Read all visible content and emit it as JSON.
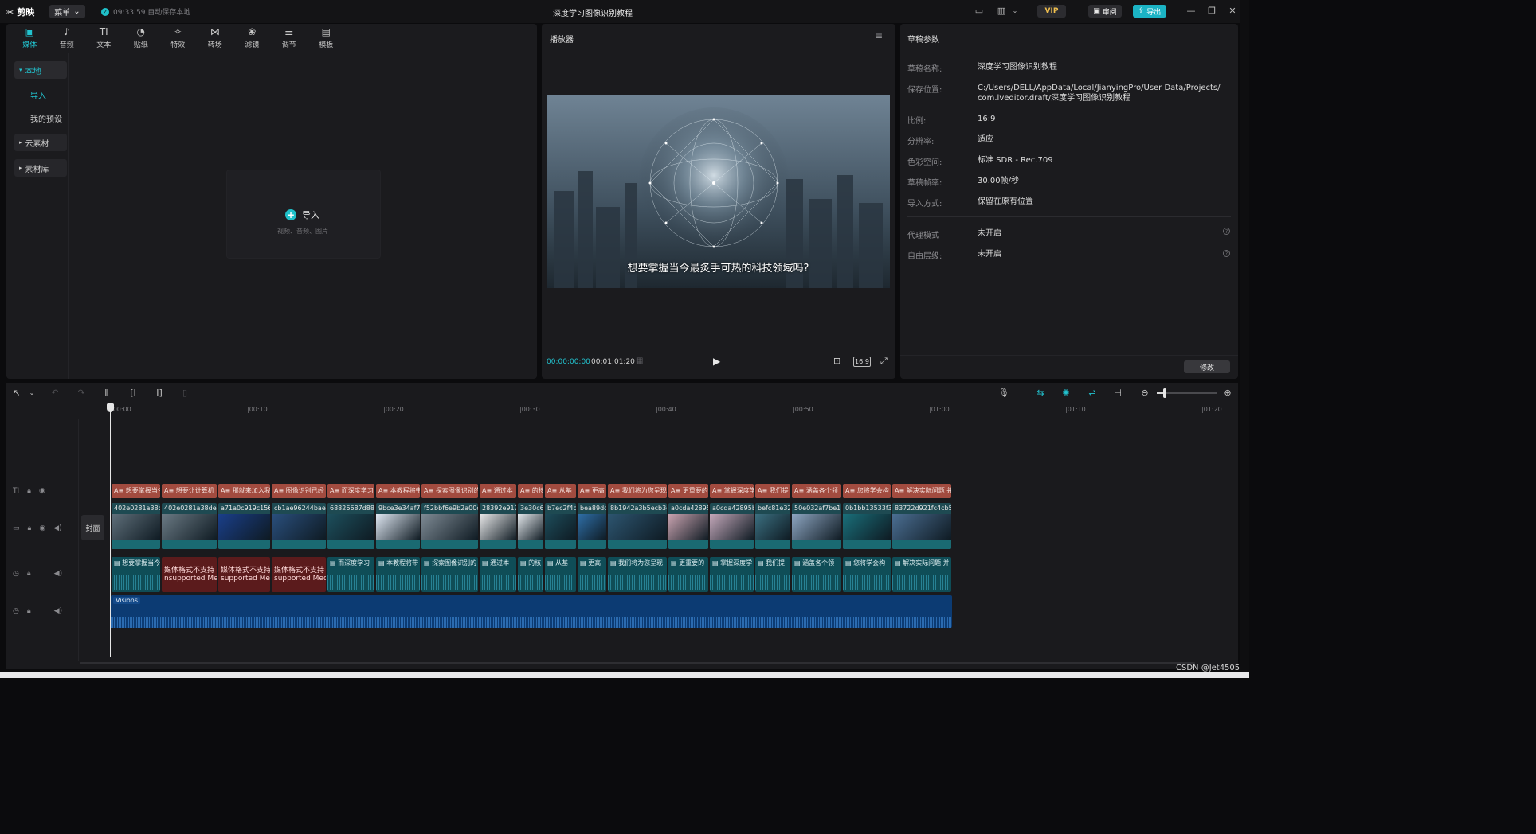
{
  "titlebar": {
    "app_name": "剪映",
    "menu_label": "菜单",
    "autosave": "09:33:59 自动保存本地",
    "project_title": "深度学习图像识别教程",
    "vip": "VIP",
    "review": "审阅",
    "export": "导出"
  },
  "tabs": [
    {
      "label": "媒体",
      "icon": "▣"
    },
    {
      "label": "音频",
      "icon": "♪"
    },
    {
      "label": "文本",
      "icon": "TI"
    },
    {
      "label": "贴纸",
      "icon": "◔"
    },
    {
      "label": "特效",
      "icon": "✧"
    },
    {
      "label": "转场",
      "icon": "⋈"
    },
    {
      "label": "滤镜",
      "icon": "❀"
    },
    {
      "label": "调节",
      "icon": "⚌"
    },
    {
      "label": "模板",
      "icon": "▤"
    }
  ],
  "sidebar": {
    "local": "本地",
    "import": "导入",
    "my_presets": "我的预设",
    "cloud": "云素材",
    "library": "素材库"
  },
  "import_card": {
    "label": "导入",
    "sub": "视频、音频、图片"
  },
  "player": {
    "title": "播放器",
    "subtitle": "想要掌握当今最炙手可热的科技领域吗?",
    "current_time": "00:00:00:00",
    "total_time": "00:01:01:20",
    "ratio": "16:9"
  },
  "params": {
    "title": "草稿参数",
    "rows": [
      {
        "label": "草稿名称:",
        "value": "深度学习图像识别教程"
      },
      {
        "label": "保存位置:",
        "value": "C:/Users/DELL/AppData/Local/JianyingPro/User Data/Projects/",
        "value2": "com.lveditor.draft/深度学习图像识别教程"
      },
      {
        "label": "比例:",
        "value": "16:9"
      },
      {
        "label": "分辨率:",
        "value": "适应"
      },
      {
        "label": "色彩空间:",
        "value": "标准 SDR - Rec.709"
      },
      {
        "label": "草稿帧率:",
        "value": "30.00帧/秒"
      },
      {
        "label": "导入方式:",
        "value": "保留在原有位置"
      },
      {
        "label": "代理模式",
        "value": "未开启"
      },
      {
        "label": "自由层级:",
        "value": "未开启"
      }
    ],
    "modify": "修改"
  },
  "ruler": [
    "|00:00",
    "|00:10",
    "|00:20",
    "|00:30",
    "|00:40",
    "|00:50",
    "|01:00",
    "|01:10",
    "|01:20"
  ],
  "cover": "封面",
  "text_clips": [
    "想要掌握当今",
    "想要让计算机",
    "那就来加入我",
    "图像识别已经",
    "而深度学习",
    "本教程将带",
    "探索图像识别的",
    "通过本",
    "的核",
    "从基",
    "更高",
    "我们将为您呈现",
    "更重要的",
    "掌握深度学",
    "我们提",
    "涵盖各个领",
    "您将学会构",
    "解决实际问题 并"
  ],
  "video_clips": [
    "402e0281a38c",
    "402e0281a38dec",
    "a71a0c919c156",
    "cb1ae96244bae8",
    "68826687d88",
    "9bce3e34af7",
    "f52bbf6e9b2a00c",
    "28392e912",
    "3e30c6",
    "b7ec2f4c",
    "bea89dc",
    "8b1942a3b5ecb3d",
    "a0cda42895",
    "a0cda42895bf",
    "befc81e32",
    "50e032af7be1l",
    "0b1bb13533f3",
    "83722d921fc4cb5"
  ],
  "audio_clips": [
    "想要掌握当今",
    "媒体格式不支持",
    "媒体格式不支持",
    "媒体格式不支持",
    "而深度学习",
    "本教程将带",
    "探索图像识别的",
    "通过本",
    "的核",
    "从基",
    "更高",
    "我们将为您呈现",
    "更重要的",
    "掌握深度学",
    "我们提",
    "涵盖各个领",
    "您将学会构",
    "解决实际问题 并"
  ],
  "unsupported_sub": [
    "nsupported Med",
    "supported Mec",
    "supported Med"
  ],
  "music": "Visions",
  "watermark": "CSDN @Jet4505"
}
